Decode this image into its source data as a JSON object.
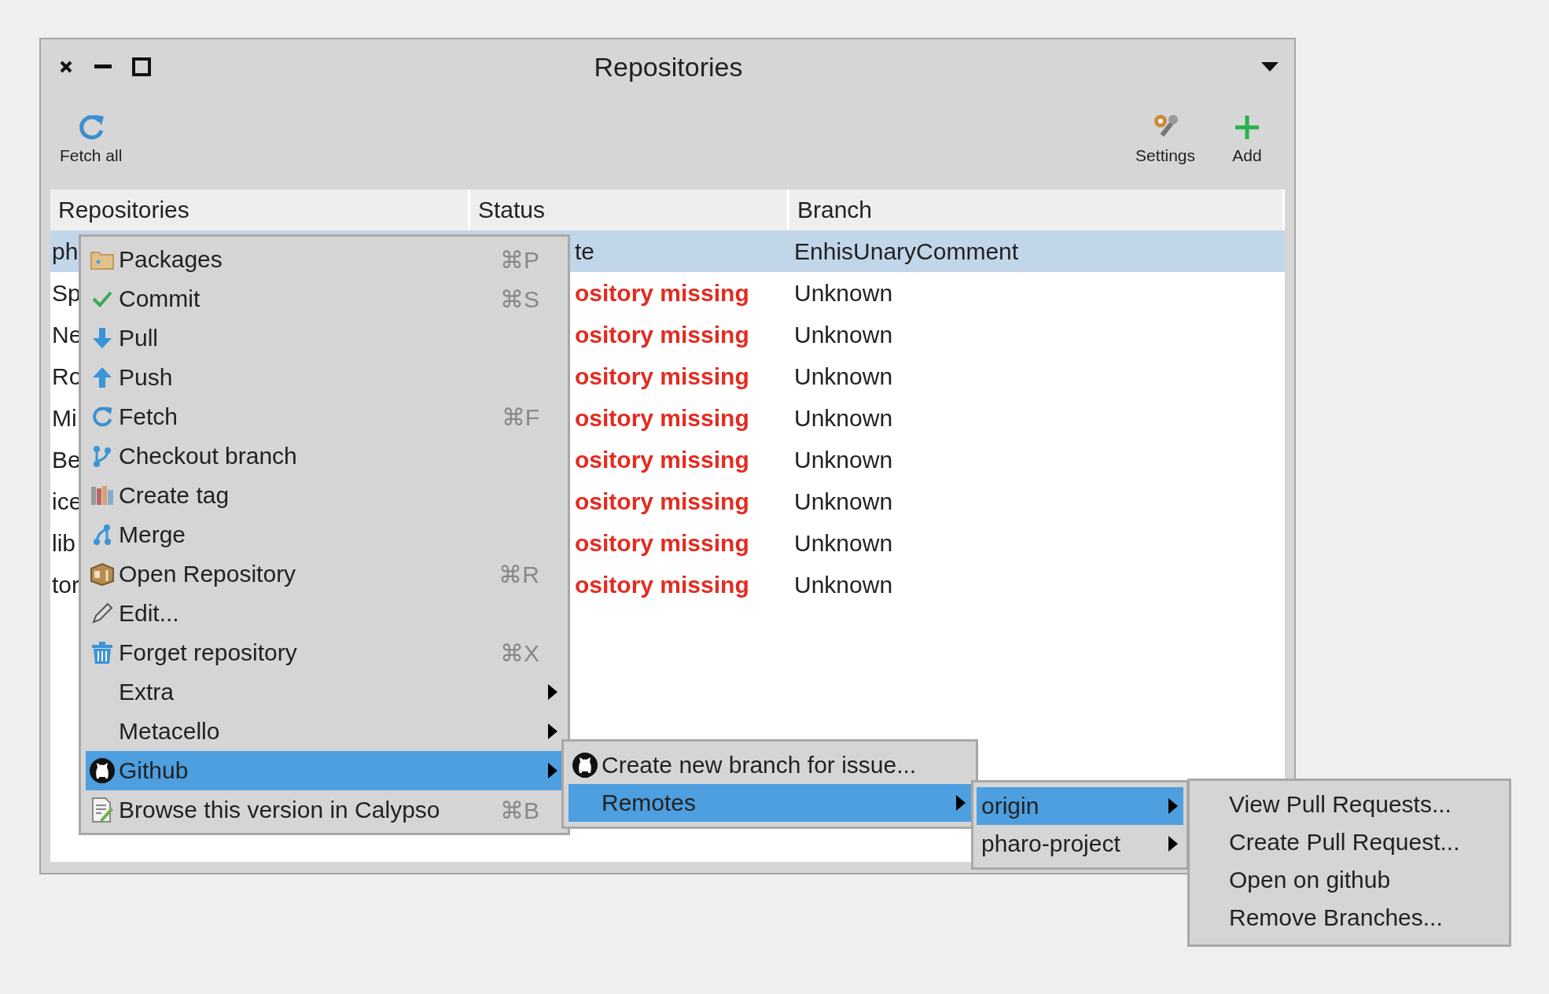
{
  "window": {
    "title": "Repositories"
  },
  "toolbar": {
    "left_buttons": [
      {
        "label": "Fetch all"
      }
    ],
    "right_buttons": [
      {
        "label": "Settings"
      },
      {
        "label": "Add"
      }
    ]
  },
  "table": {
    "columns": [
      "Repositories",
      "Status",
      "Branch"
    ],
    "rows": [
      {
        "repository": "ph",
        "status": "te",
        "status_error": false,
        "branch": "EnhisUnaryComment",
        "selected": true
      },
      {
        "repository": "Sp",
        "status": "ository missing",
        "status_error": true,
        "branch": "Unknown",
        "selected": false
      },
      {
        "repository": "Ne",
        "status": "ository missing",
        "status_error": true,
        "branch": "Unknown",
        "selected": false
      },
      {
        "repository": "Ro",
        "status": "ository missing",
        "status_error": true,
        "branch": "Unknown",
        "selected": false
      },
      {
        "repository": "Mi",
        "status": "ository missing",
        "status_error": true,
        "branch": "Unknown",
        "selected": false
      },
      {
        "repository": "Be",
        "status": "ository missing",
        "status_error": true,
        "branch": "Unknown",
        "selected": false
      },
      {
        "repository": "ice",
        "status": "ository missing",
        "status_error": true,
        "branch": "Unknown",
        "selected": false
      },
      {
        "repository": "lib",
        "status": "ository missing",
        "status_error": true,
        "branch": "Unknown",
        "selected": false
      },
      {
        "repository": "tor",
        "status": "ository missing",
        "status_error": true,
        "branch": "Unknown",
        "selected": false
      }
    ]
  },
  "context_menu": {
    "items": [
      {
        "label": "Packages",
        "shortcut": "⌘P",
        "submenu": false,
        "selected": false
      },
      {
        "label": "Commit",
        "shortcut": "⌘S",
        "submenu": false,
        "selected": false
      },
      {
        "label": "Pull",
        "submenu": false,
        "selected": false
      },
      {
        "label": "Push",
        "submenu": false,
        "selected": false
      },
      {
        "label": "Fetch",
        "shortcut": "⌘F",
        "submenu": false,
        "selected": false
      },
      {
        "label": "Checkout branch",
        "submenu": false,
        "selected": false
      },
      {
        "label": "Create tag",
        "submenu": false,
        "selected": false
      },
      {
        "label": "Merge",
        "submenu": false,
        "selected": false
      },
      {
        "label": "Open Repository",
        "shortcut": "⌘R",
        "submenu": false,
        "selected": false
      },
      {
        "label": "Edit...",
        "submenu": false,
        "selected": false
      },
      {
        "label": "Forget repository",
        "shortcut": "⌘X",
        "submenu": false,
        "selected": false
      },
      {
        "label": "Extra",
        "submenu": true,
        "selected": false
      },
      {
        "label": "Metacello",
        "submenu": true,
        "selected": false
      },
      {
        "label": "Github",
        "submenu": true,
        "selected": true
      },
      {
        "label": "Browse this version in Calypso",
        "shortcut": "⌘B",
        "submenu": false,
        "selected": false
      }
    ]
  },
  "github_submenu": {
    "items": [
      {
        "label": "Create new branch for issue...",
        "submenu": false,
        "selected": false
      },
      {
        "label": "Remotes",
        "submenu": true,
        "selected": true
      }
    ]
  },
  "remotes_submenu": {
    "items": [
      {
        "label": "origin",
        "submenu": true,
        "selected": true
      },
      {
        "label": "pharo-project",
        "submenu": true,
        "selected": false
      }
    ]
  },
  "origin_submenu": {
    "items": [
      {
        "label": "View Pull Requests...",
        "selected": false
      },
      {
        "label": "Create Pull Request...",
        "selected": false
      },
      {
        "label": "Open on github",
        "selected": false
      },
      {
        "label": "Remove Branches...",
        "selected": false
      }
    ]
  }
}
